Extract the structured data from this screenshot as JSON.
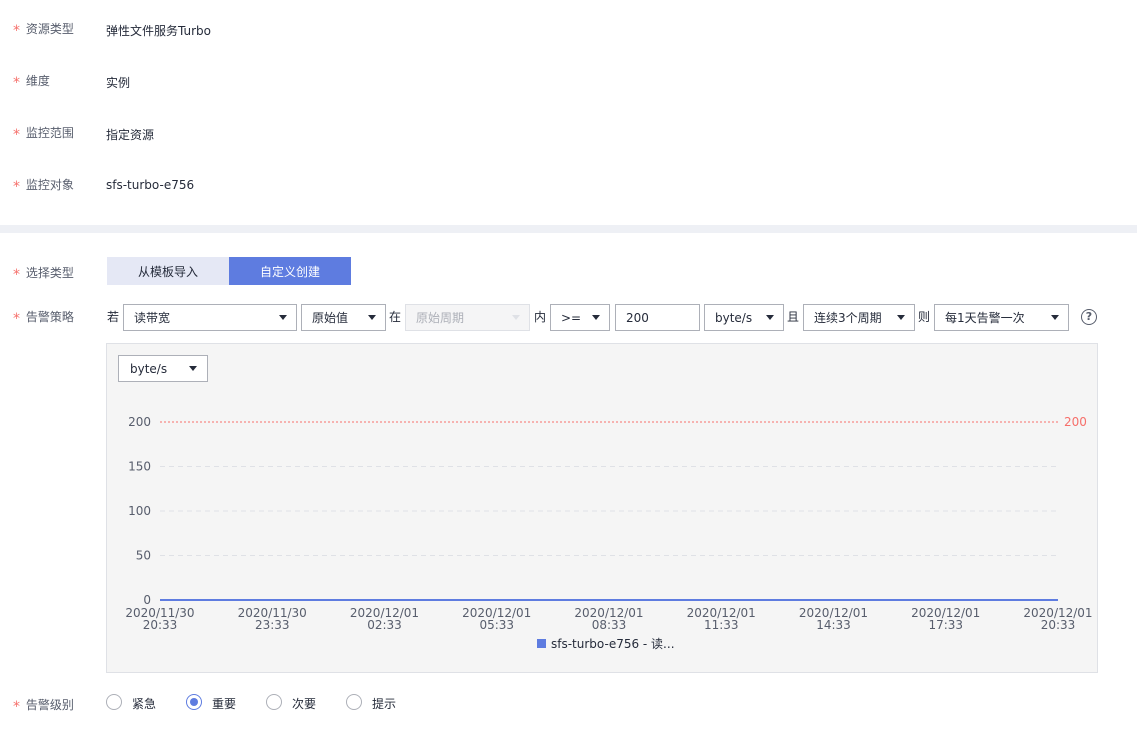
{
  "form": {
    "resource_type_label": "资源类型",
    "resource_type_value": "弹性文件服务Turbo",
    "dimension_label": "维度",
    "dimension_value": "实例",
    "scope_label": "监控范围",
    "scope_value": "指定资源",
    "target_label": "监控对象",
    "target_value": "sfs-turbo-e756",
    "select_type_label": "选择类型",
    "tab_template": "从模板导入",
    "tab_custom": "自定义创建",
    "policy_label": "告警策略",
    "level_label": "告警级别",
    "required_mark": "*"
  },
  "policy": {
    "if_text": "若",
    "metric": "读带宽",
    "agg": "原始值",
    "in_text": "在",
    "period_placeholder": "原始周期",
    "within_text": "内",
    "operator": ">=",
    "threshold": "200",
    "unit": "byte/s",
    "and_text": "且",
    "consecutive": "连续3个周期",
    "then_text": "则",
    "frequency": "每1天告警一次",
    "help_icon": "?"
  },
  "chart_unit": "byte/s",
  "chart_data": {
    "type": "line",
    "x": [
      "2020/11/30 20:33",
      "2020/11/30 23:33",
      "2020/12/01 02:33",
      "2020/12/01 05:33",
      "2020/12/01 08:33",
      "2020/12/01 11:33",
      "2020/12/01 14:33",
      "2020/12/01 17:33",
      "2020/12/01 20:33"
    ],
    "x_labels": [
      [
        "2020/11/30",
        "20:33"
      ],
      [
        "2020/11/30",
        "23:33"
      ],
      [
        "2020/12/01",
        "02:33"
      ],
      [
        "2020/12/01",
        "05:33"
      ],
      [
        "2020/12/01",
        "08:33"
      ],
      [
        "2020/12/01",
        "11:33"
      ],
      [
        "2020/12/01",
        "14:33"
      ],
      [
        "2020/12/01",
        "17:33"
      ],
      [
        "2020/12/01",
        "20:33"
      ]
    ],
    "series": [
      {
        "name": "sfs-turbo-e756 - 读...",
        "values": [
          0,
          0,
          0,
          0,
          0,
          0,
          0,
          0,
          0
        ],
        "color": "#5e7ce0"
      }
    ],
    "threshold": {
      "value": 200,
      "label": "200",
      "color": "#f66f6a"
    },
    "yticks": [
      200,
      150,
      100,
      50,
      0
    ],
    "ylim": [
      0,
      200
    ],
    "grid": true,
    "legend": "bottom-center"
  },
  "levels": [
    {
      "label": "紧急",
      "checked": false
    },
    {
      "label": "重要",
      "checked": true
    },
    {
      "label": "次要",
      "checked": false
    },
    {
      "label": "提示",
      "checked": false
    }
  ]
}
